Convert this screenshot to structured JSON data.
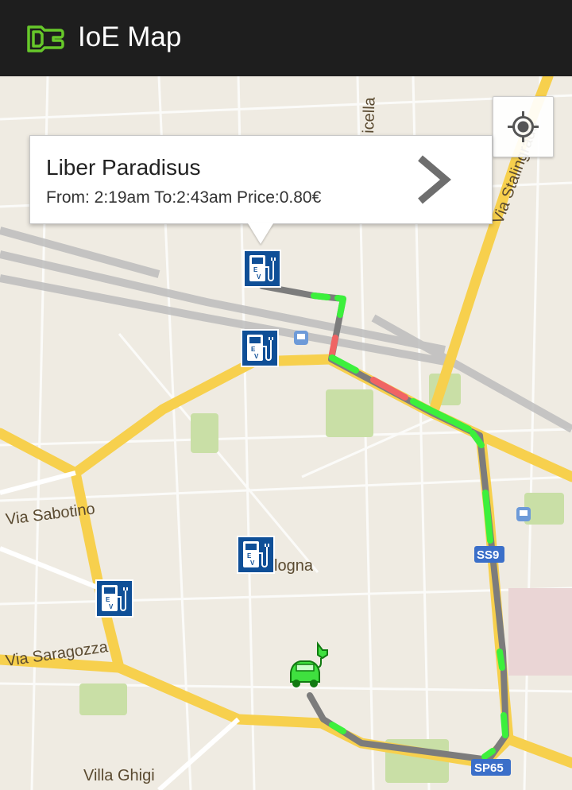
{
  "app_bar": {
    "title": "IoE Map",
    "logo_icon": "ev-plug-icon",
    "background": "#1e1e1e",
    "accent": "#67c82a"
  },
  "info_window": {
    "station_name": "Liber Paradisus",
    "detail": "From: 2:19am To:2:43am Price:0.80€",
    "arrow_icon": "chevron-right-icon"
  },
  "map": {
    "street_labels": [
      "Via Sabotino",
      "Via Saragozza",
      "Via Stalingrado",
      "Villa Ghigi",
      "logna",
      "icella"
    ],
    "road_shields": [
      "SS9",
      "SP65"
    ],
    "route_colors": {
      "gray": "#7c7c7c",
      "green": "#3cf03c",
      "red": "#f06464"
    },
    "markers": [
      {
        "type": "ev-station",
        "label": "E V"
      },
      {
        "type": "ev-station",
        "label": "E V"
      },
      {
        "type": "ev-station",
        "label": "E V"
      },
      {
        "type": "ev-station",
        "label": "E V"
      }
    ],
    "vehicle_icon": "green-ev-car-icon",
    "locate_icon": "my-location-icon"
  }
}
